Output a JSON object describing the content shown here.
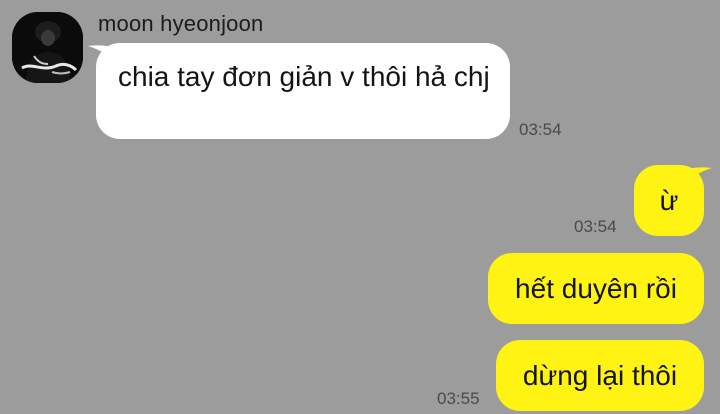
{
  "contact": {
    "name": "moon hyeonjoon"
  },
  "messages": [
    {
      "direction": "incoming",
      "text": "chia tay đơn giản v thôi hả chj",
      "time": "03:54"
    },
    {
      "direction": "outgoing",
      "text": "ừ",
      "time": "03:54"
    },
    {
      "direction": "outgoing",
      "text": "hết duyên rồi",
      "time": ""
    },
    {
      "direction": "outgoing",
      "text": "dừng lại thôi",
      "time": "03:55"
    }
  ],
  "colors": {
    "background": "#9c9c9c",
    "incoming_bubble": "#ffffff",
    "outgoing_bubble": "#fff314",
    "timestamp_text": "#4a4a4a"
  },
  "icons": {
    "avatar": "profile-photo"
  }
}
